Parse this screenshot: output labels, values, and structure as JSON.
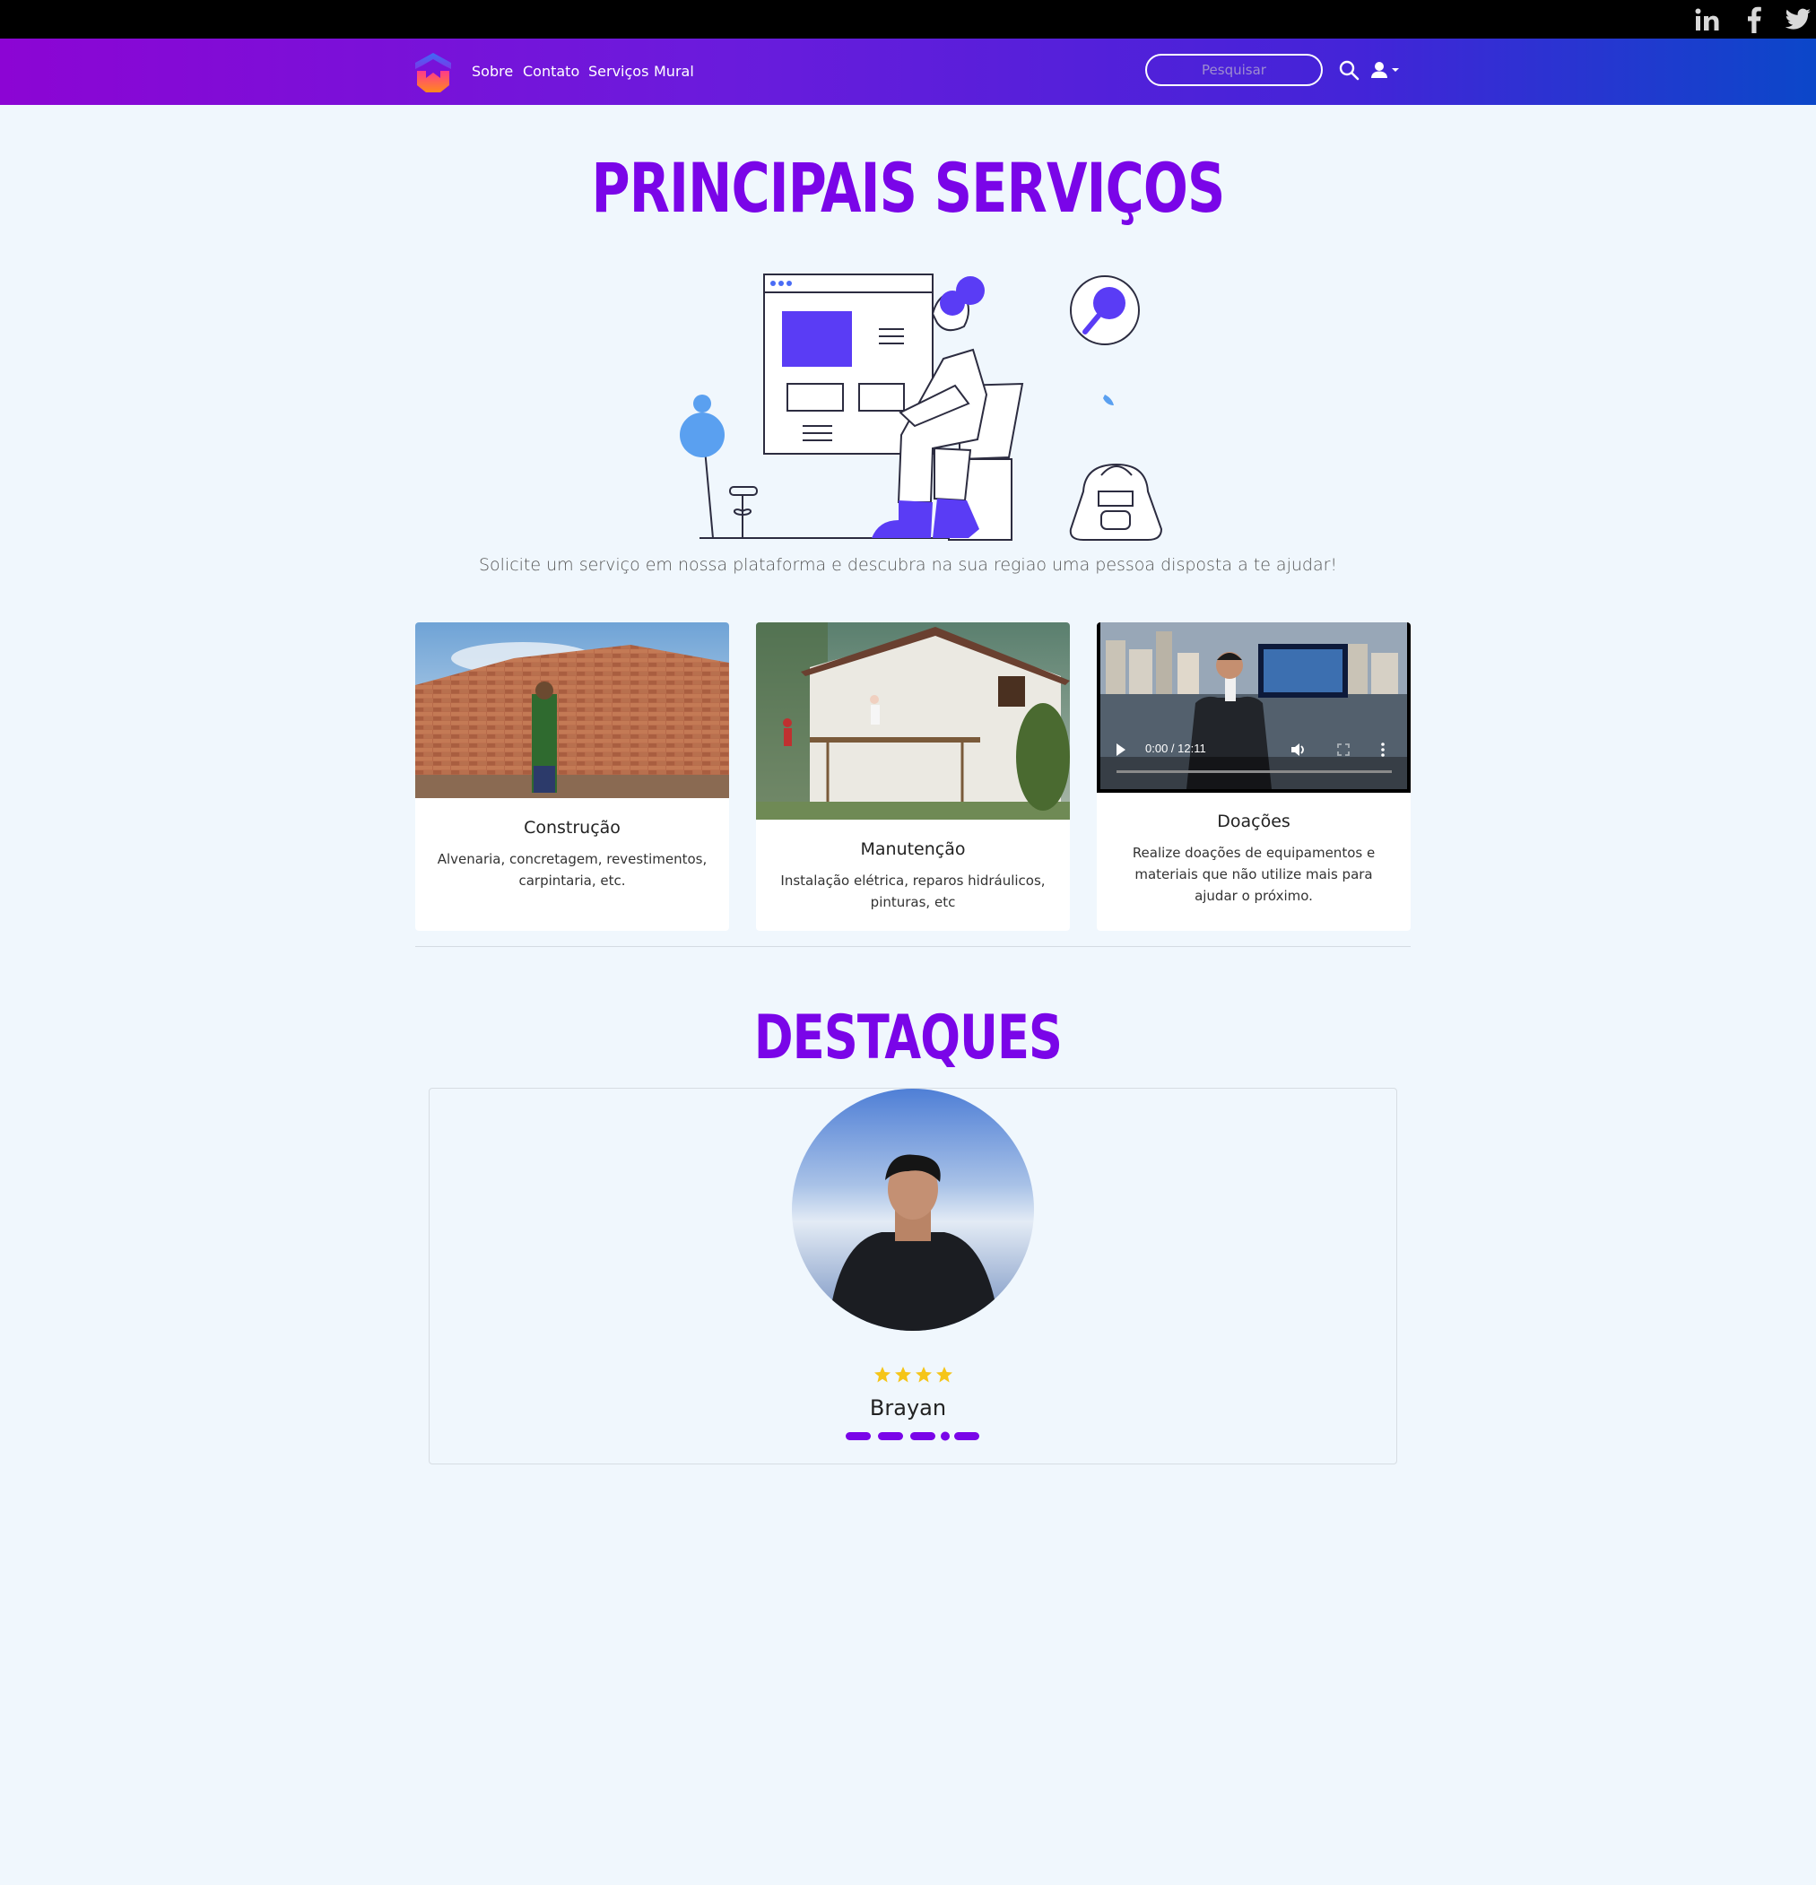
{
  "social": {
    "linkedin": "in",
    "facebook": "f",
    "twitter": "twitter-bird-icon"
  },
  "nav": {
    "items": [
      {
        "label": "Sobre"
      },
      {
        "label": "Contato"
      },
      {
        "label": "Serviços"
      },
      {
        "label": "Mural"
      }
    ],
    "search_placeholder": "Pesquisar"
  },
  "services": {
    "title": "PRINCIPAIS SERVIÇOS",
    "subtitle": "Solicite um serviço em nossa plataforma e descubra na sua regiao uma pessoa disposta a te ajudar!",
    "cards": [
      {
        "title": "Construção",
        "text": "Alvenaria, concretagem, revestimentos, carpintaria, etc."
      },
      {
        "title": "Manutenção",
        "text": "Instalação elétrica, reparos hidráulicos, pinturas, etc"
      },
      {
        "title": "Doações",
        "text": "Realize doações de equipamentos e materiais que não utilize mais para ajudar o próximo."
      }
    ],
    "video": {
      "time": "0:00 / 12:11"
    }
  },
  "highlights": {
    "title": "DESTAQUES",
    "person": {
      "name": "Brayan",
      "rating": 4
    }
  },
  "colors": {
    "accent": "#7a05e8",
    "star": "#f5c518",
    "nav_start": "#8c05d4",
    "nav_end": "#0b47c9"
  }
}
